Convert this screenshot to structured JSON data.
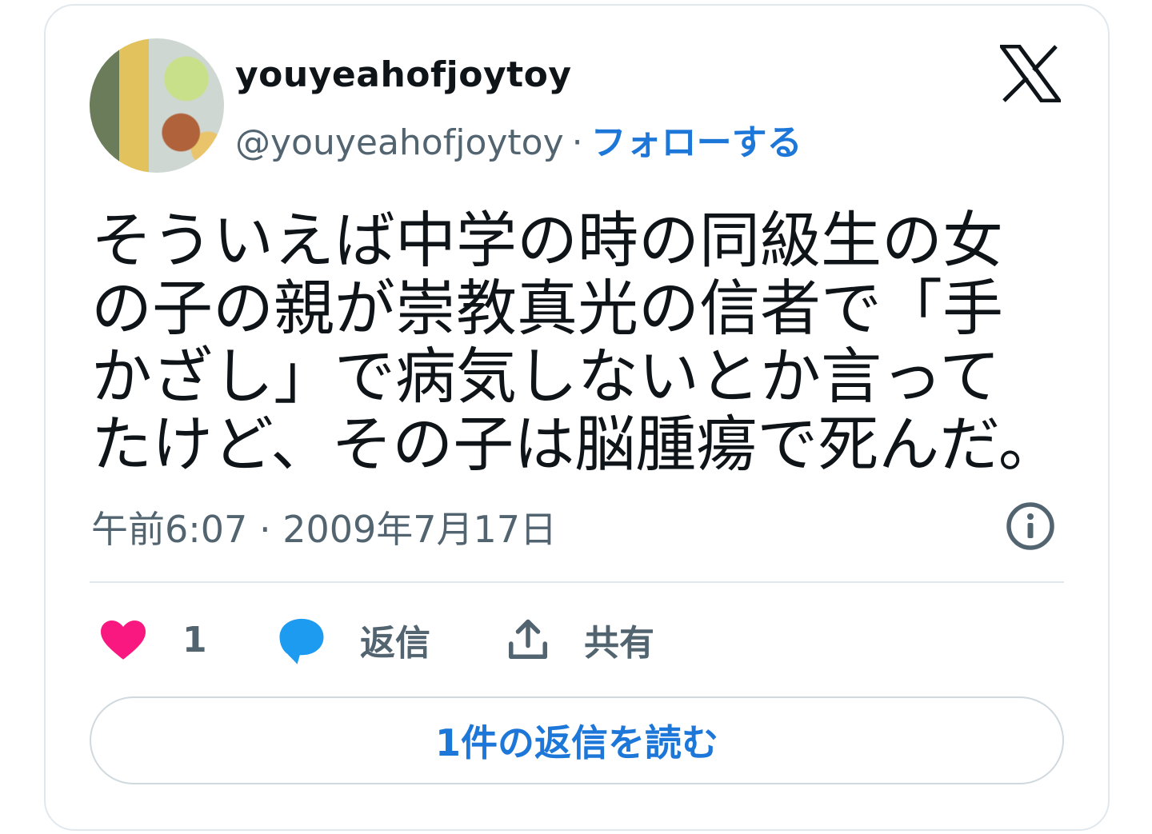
{
  "author": {
    "display_name": "youyeahofjoytoy",
    "handle": "@youyeahofjoytoy",
    "separator": "·",
    "follow_label": "フォローする"
  },
  "tweet": {
    "text": "そういえば中学の時の同級生の女の子の親が崇教真光の信者で「手かざし」で病気しないとか言ってたけど、その子は脳腫瘍で死んだ。",
    "time": "午前6:07",
    "separator": "·",
    "date": "2009年7月17日"
  },
  "actions": {
    "like_count": "1",
    "reply_label": "返信",
    "share_label": "共有"
  },
  "read_replies_label": "1件の返信を読む",
  "colors": {
    "accent": "#1d77d8",
    "like": "#f91880",
    "reply": "#1d9bf0",
    "muted": "#536471"
  },
  "icons": {
    "brand": "x-logo-icon",
    "info": "info-icon",
    "like": "heart-icon",
    "reply": "speech-bubble-icon",
    "share": "share-icon"
  }
}
